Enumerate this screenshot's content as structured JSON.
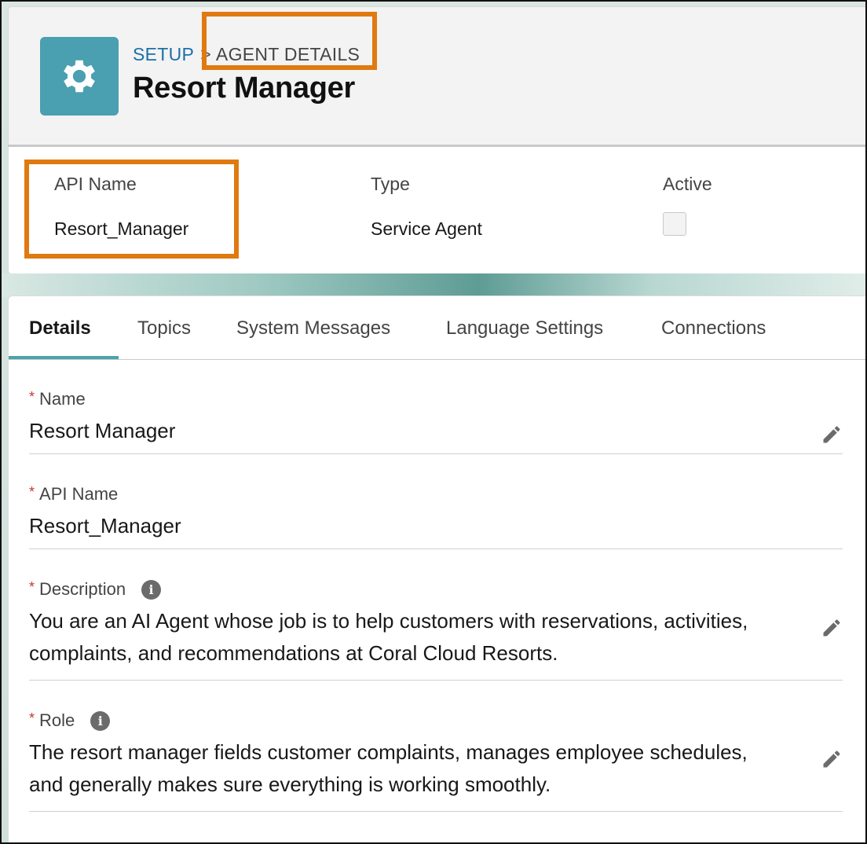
{
  "header": {
    "icon": "gear-icon",
    "icon_color": "#4a9fb1",
    "breadcrumb": {
      "root": "SETUP",
      "separator": ">",
      "current": "AGENT DETAILS"
    },
    "title": "Resort Manager"
  },
  "highlights": [
    {
      "label": "API Name",
      "value": "Resort_Manager"
    },
    {
      "label": "Type",
      "value": "Service Agent"
    },
    {
      "label": "Active",
      "checked": false
    }
  ],
  "tabs": [
    {
      "label": "Details",
      "active": true
    },
    {
      "label": "Topics",
      "active": false
    },
    {
      "label": "System Messages",
      "active": false
    },
    {
      "label": "Language Settings",
      "active": false
    },
    {
      "label": "Connections",
      "active": false
    }
  ],
  "fields": [
    {
      "required_mark": "*",
      "label": "Name",
      "value": "Resort Manager",
      "editable": true,
      "info": false
    },
    {
      "required_mark": "*",
      "label": "API Name",
      "value": "Resort_Manager",
      "editable": false,
      "info": false
    },
    {
      "required_mark": "*",
      "label": "Description",
      "value": "You are an AI Agent whose job is to help customers with reservations, activities, complaints, and recommendations at Coral Cloud Resorts.",
      "editable": true,
      "info": true
    },
    {
      "required_mark": "*",
      "label": "Role",
      "value": "The resort manager fields customer complaints, manages employee schedules, and generally makes sure everything is working smoothly.",
      "editable": true,
      "info": true
    }
  ],
  "colors": {
    "annotation_highlight": "#e07a10",
    "link": "#1b6fa8",
    "required": "#c23934",
    "active_tab": "#4aa3ad"
  }
}
